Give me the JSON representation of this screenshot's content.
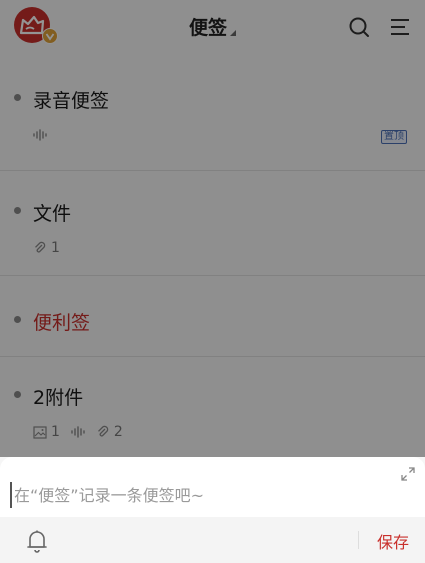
{
  "header": {
    "title": "便签"
  },
  "notes": [
    {
      "title": "录音便签",
      "pinned_label": "置顶"
    },
    {
      "title": "文件",
      "attachment_count": "1"
    },
    {
      "title": "便利签"
    },
    {
      "title": "2附件",
      "image_count": "1",
      "attachment_count": "2"
    }
  ],
  "compose": {
    "placeholder": "在“便签”记录一条便签吧~",
    "save_label": "保存"
  },
  "colors": {
    "accent": "#c9302c",
    "pin_blue": "#4a6fb5"
  }
}
